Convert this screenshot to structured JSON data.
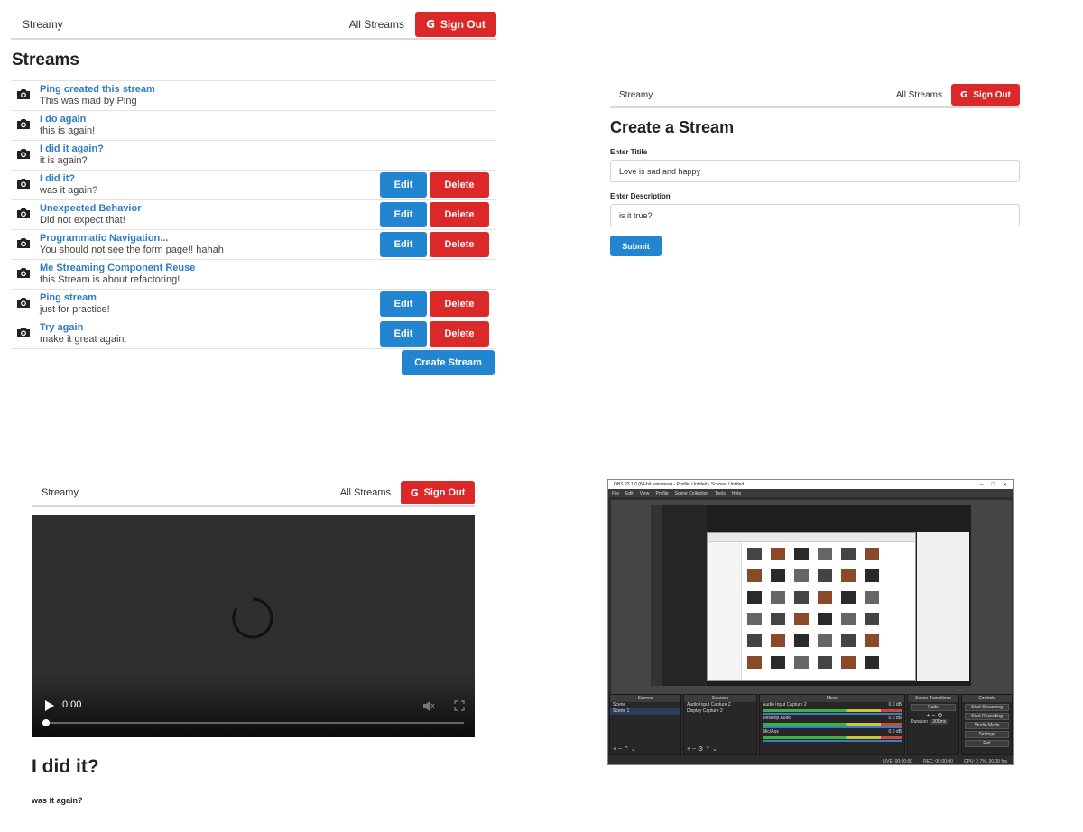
{
  "nav": {
    "brand": "Streamy",
    "all_streams": "All Streams",
    "sign_out": "Sign Out"
  },
  "list": {
    "heading": "Streams",
    "edit_label": "Edit",
    "delete_label": "Delete",
    "create_label": "Create Stream",
    "streams": [
      {
        "title": "Ping created this stream",
        "description": "This was mad by Ping",
        "owned": false
      },
      {
        "title": "I do again",
        "description": "this is again!",
        "owned": false
      },
      {
        "title": "I did it again?",
        "description": "it is again?",
        "owned": false
      },
      {
        "title": "I did it?",
        "description": "was it again?",
        "owned": true
      },
      {
        "title": "Unexpected Behavior",
        "description": "Did not expect that!",
        "owned": true
      },
      {
        "title": "Programmatic Navigation...",
        "description": "You should not see the form page!! hahah",
        "owned": true
      },
      {
        "title": "Me Streaming Component Reuse",
        "description": "this Stream is about refactoring!",
        "owned": false
      },
      {
        "title": "Ping stream",
        "description": "just for practice!",
        "owned": true
      },
      {
        "title": "Try again",
        "description": "make it great again.",
        "owned": true
      }
    ]
  },
  "create_form": {
    "heading": "Create a Stream",
    "title_label": "Enter Titile",
    "title_value": "Love is sad and happy",
    "description_label": "Enter Description",
    "description_value": "is it true?",
    "submit_label": "Submit"
  },
  "show": {
    "time": "0:00",
    "title": "I did it?",
    "description": "was it again?"
  },
  "obs": {
    "window_title": "OBS 23.1.0 (64-bit, windows) - Profile: Untitled - Scenes: Untitled",
    "menu": [
      "File",
      "Edit",
      "View",
      "Profile",
      "Scene Collection",
      "Tools",
      "Help"
    ],
    "docks": {
      "scenes_header": "Scenes",
      "scenes": [
        "Scene",
        "Scene 1"
      ],
      "sources_header": "Sources",
      "sources": [
        "Audio Input Capture 2",
        "Display Capture 2"
      ],
      "mixer_header": "Mixer",
      "mixer": [
        {
          "name": "Audio Input Capture 2",
          "level": "0.0 dB"
        },
        {
          "name": "Desktop Audio",
          "level": "0.0 dB"
        },
        {
          "name": "Mic/Aux",
          "level": "0.0 dB"
        }
      ],
      "transitions_header": "Scene Transitions",
      "transition": "Fade",
      "duration_label": "Duration",
      "duration_value": "300ms",
      "controls_header": "Controls",
      "controls": [
        "Start Streaming",
        "Start Recording",
        "Studio Mode",
        "Settings",
        "Exit"
      ]
    },
    "status": {
      "live": "LIVE: 00:00:00",
      "rec": "REC: 00:00:00",
      "cpu": "CPU: 2.7%, 30.00 fps"
    }
  },
  "colors": {
    "primary": "#2185d0",
    "danger": "#db2828",
    "link": "#2d7dc6"
  }
}
